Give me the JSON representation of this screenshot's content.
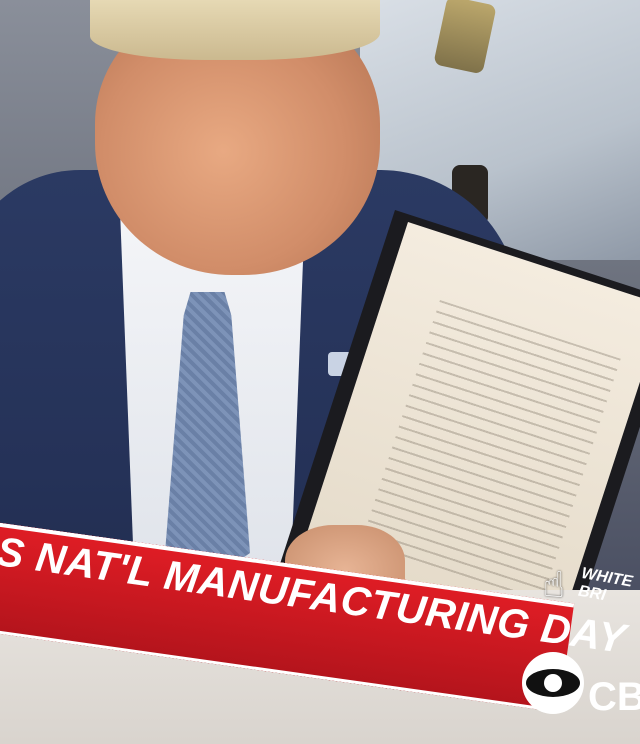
{
  "image": {
    "description_alt": "Man in navy suit holding a signed document during a televised event",
    "chyron": {
      "headline": "S NAT'L MANUFACTURING DAY",
      "side_caption_lines": [
        "WHITE",
        "BRI"
      ],
      "network_abbrev": "CB"
    },
    "icons": {
      "cursor": "hand-pointer-icon",
      "network_logo": "eye-logo-icon"
    },
    "colors": {
      "banner_red": "#d21a22",
      "banner_text": "#ffffff",
      "suit": "#253258"
    }
  }
}
